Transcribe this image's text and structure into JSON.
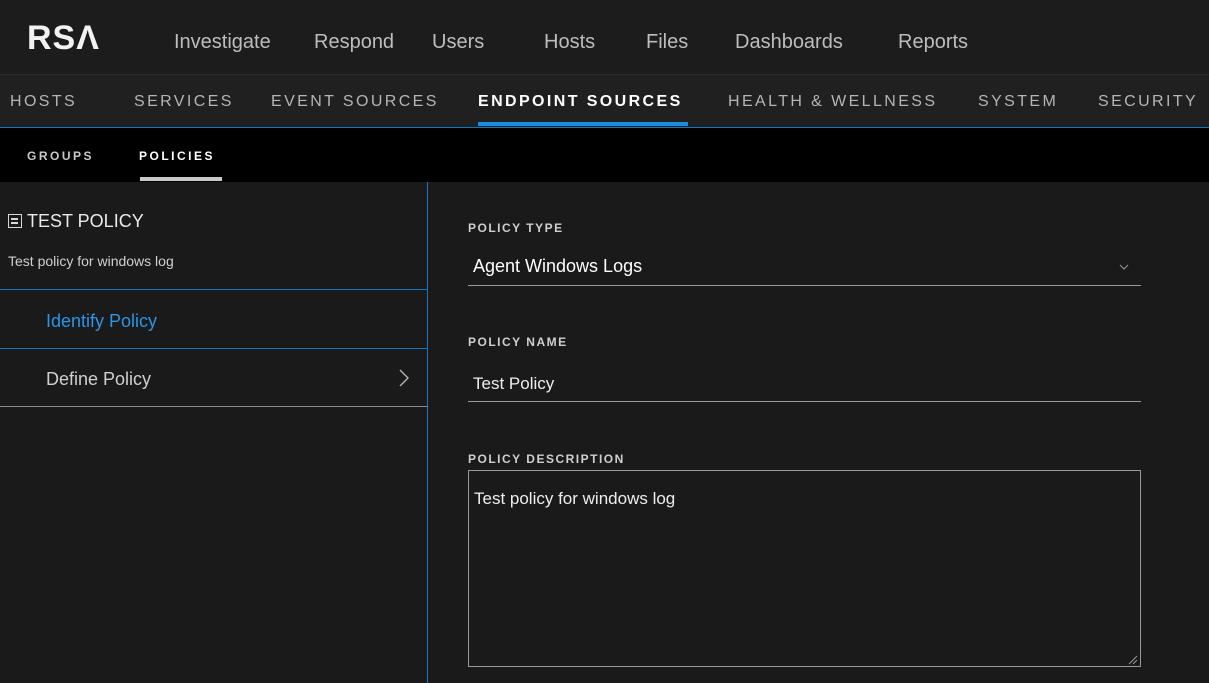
{
  "brand": {
    "logo_text": "RSΛ"
  },
  "topnav": {
    "items": [
      {
        "label": "Investigate"
      },
      {
        "label": "Respond"
      },
      {
        "label": "Users"
      },
      {
        "label": "Hosts"
      },
      {
        "label": "Files"
      },
      {
        "label": "Dashboards"
      },
      {
        "label": "Reports"
      }
    ]
  },
  "admin_tabs": {
    "items": [
      {
        "label": "HOSTS"
      },
      {
        "label": "SERVICES"
      },
      {
        "label": "EVENT SOURCES"
      },
      {
        "label": "ENDPOINT SOURCES",
        "active": true
      },
      {
        "label": "HEALTH & WELLNESS"
      },
      {
        "label": "SYSTEM"
      },
      {
        "label": "SECURITY"
      }
    ]
  },
  "sub_tabs": {
    "items": [
      {
        "label": "GROUPS"
      },
      {
        "label": "POLICIES",
        "active": true
      }
    ]
  },
  "left_panel": {
    "policy_title": "TEST POLICY",
    "policy_subtitle": "Test policy for windows log",
    "steps": [
      {
        "label": "Identify Policy",
        "active": true
      },
      {
        "label": "Define Policy"
      }
    ]
  },
  "form": {
    "policy_type": {
      "label": "POLICY TYPE",
      "value": "Agent Windows Logs"
    },
    "policy_name": {
      "label": "POLICY NAME",
      "value": "Test Policy"
    },
    "policy_description": {
      "label": "POLICY DESCRIPTION",
      "value": "Test policy for windows log"
    }
  },
  "colors": {
    "accent_blue": "#1b8be0",
    "active_step_text": "#2b95e9",
    "background": "#1a1a1a"
  },
  "icons": [
    "policy-icon",
    "chevron-right-icon",
    "chevron-down-icon",
    "resize-grip-icon"
  ]
}
